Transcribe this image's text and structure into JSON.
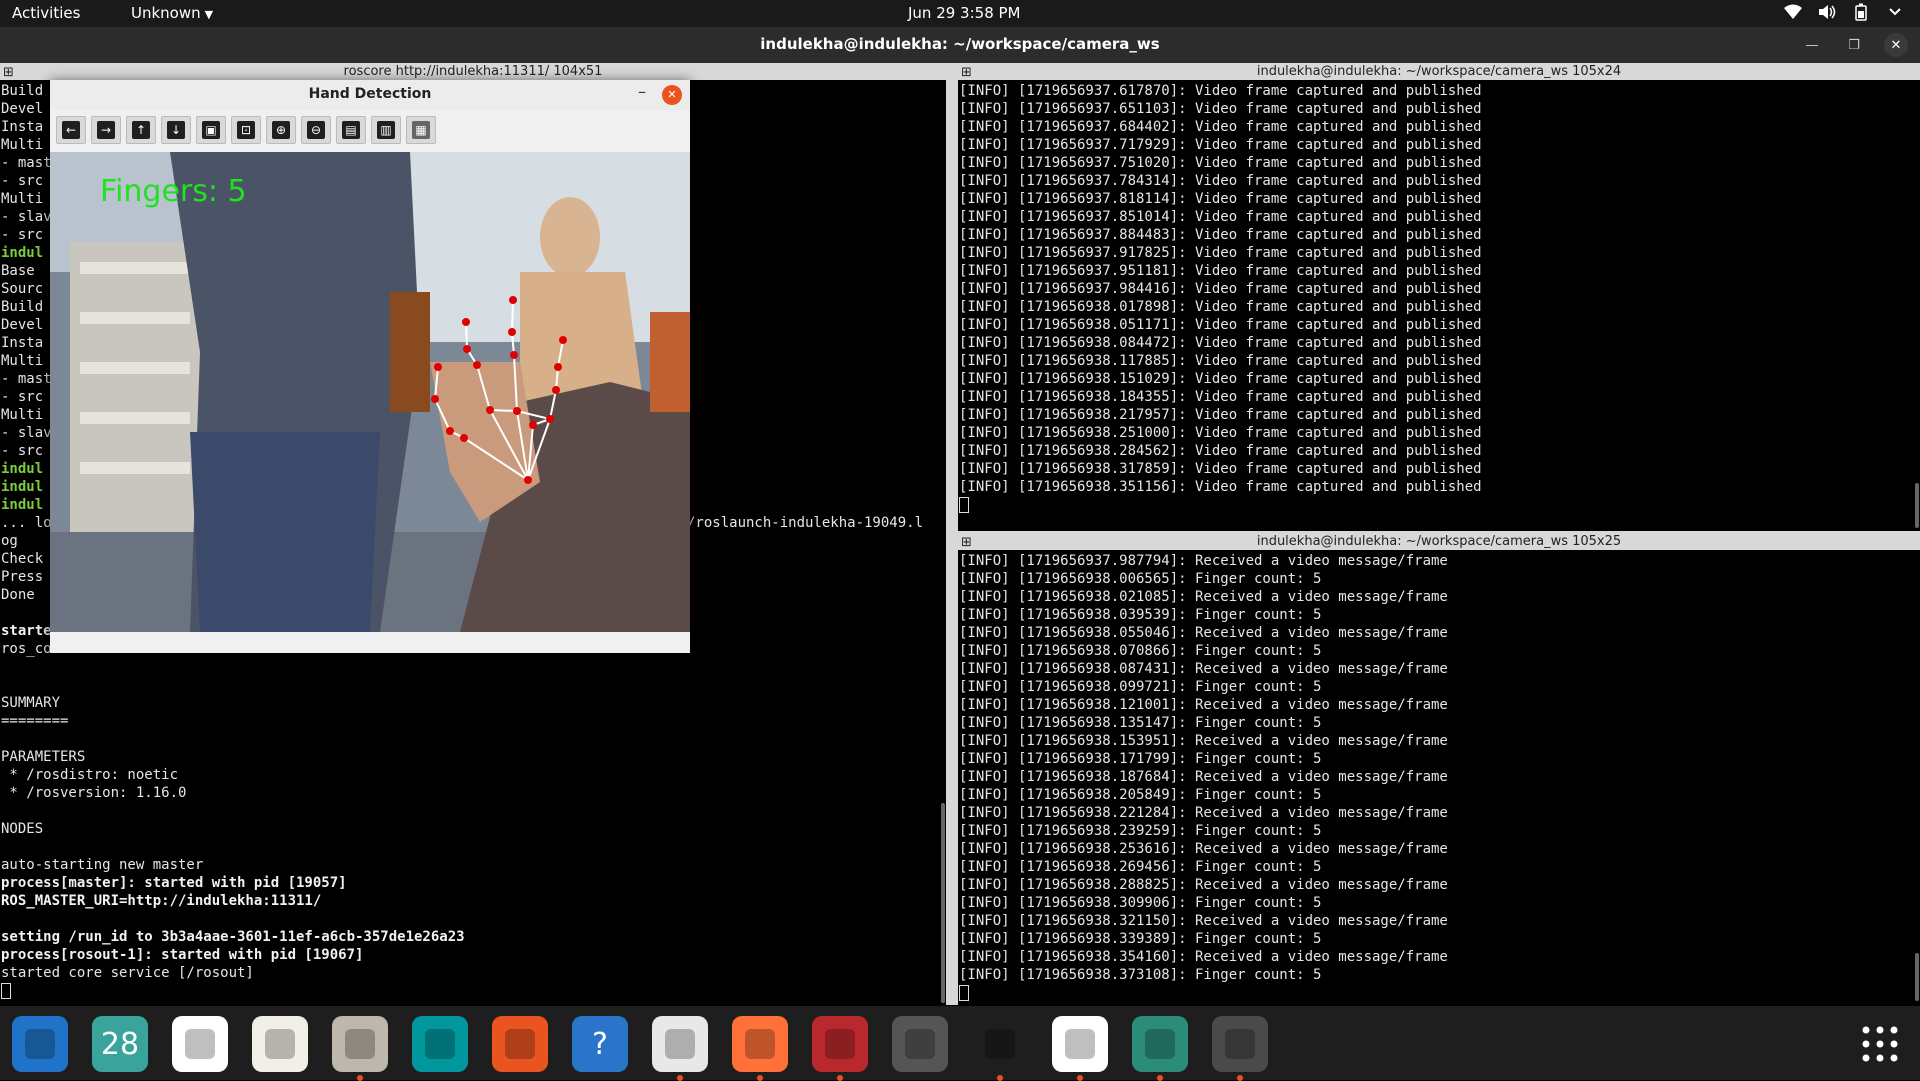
{
  "topbar": {
    "activities": "Activities",
    "app_menu": "Unknown",
    "clock": "Jun 29  3:58 PM"
  },
  "window": {
    "title": "indulekha@indulekha: ~/workspace/camera_ws"
  },
  "left_pane": {
    "title": "roscore http://indulekha:11311/ 104x51",
    "lines_top": [
      {
        "t": "Build",
        "c": ""
      },
      {
        "t": "Devel",
        "c": ""
      },
      {
        "t": "Insta",
        "c": ""
      },
      {
        "t": "Multi",
        "c": ""
      },
      {
        "t": "- mast",
        "c": ""
      },
      {
        "t": "- src",
        "c": ""
      },
      {
        "t": "Multi",
        "c": ""
      },
      {
        "t": "- slav",
        "c": ""
      },
      {
        "t": "- src",
        "c": ""
      },
      {
        "t": "indul",
        "c": "g"
      },
      {
        "t": "Base",
        "c": ""
      },
      {
        "t": "Sourc",
        "c": ""
      },
      {
        "t": "Build",
        "c": ""
      },
      {
        "t": "Devel",
        "c": ""
      },
      {
        "t": "Insta",
        "c": ""
      },
      {
        "t": "Multi",
        "c": ""
      },
      {
        "t": "- mast",
        "c": ""
      },
      {
        "t": "- src",
        "c": ""
      },
      {
        "t": "Multi",
        "c": ""
      },
      {
        "t": "- slav",
        "c": ""
      },
      {
        "t": "- src",
        "c": ""
      },
      {
        "t": "indul",
        "c": "g"
      },
      {
        "t": "indul",
        "c": "g"
      },
      {
        "t": "indul",
        "c": "g"
      },
      {
        "t": "... lo",
        "c": ""
      },
      {
        "t": "og",
        "c": ""
      },
      {
        "t": "Check",
        "c": ""
      },
      {
        "t": "Press",
        "c": ""
      },
      {
        "t": "Done",
        "c": ""
      },
      {
        "t": "",
        "c": ""
      },
      {
        "t": "starte",
        "c": "b"
      },
      {
        "t": "ros_co",
        "c": ""
      }
    ],
    "log_path_fragment": "/roslaunch-indulekha-19049.l",
    "lines_bottom": [
      {
        "t": "",
        "c": ""
      },
      {
        "t": "",
        "c": ""
      },
      {
        "t": "SUMMARY",
        "c": ""
      },
      {
        "t": "========",
        "c": ""
      },
      {
        "t": "",
        "c": ""
      },
      {
        "t": "PARAMETERS",
        "c": ""
      },
      {
        "t": " * /rosdistro: noetic",
        "c": ""
      },
      {
        "t": " * /rosversion: 1.16.0",
        "c": ""
      },
      {
        "t": "",
        "c": ""
      },
      {
        "t": "NODES",
        "c": ""
      },
      {
        "t": "",
        "c": ""
      },
      {
        "t": "auto-starting new master",
        "c": ""
      },
      {
        "t": "process[master]: started with pid [19057]",
        "c": "b"
      },
      {
        "t": "ROS_MASTER_URI=http://indulekha:11311/",
        "c": "b"
      },
      {
        "t": "",
        "c": ""
      },
      {
        "t": "setting /run_id to 3b3a4aae-3601-11ef-a6cb-357de1e26a23",
        "c": "b"
      },
      {
        "t": "process[rosout-1]: started with pid [19067]",
        "c": "b"
      },
      {
        "t": "started core service [/rosout]",
        "c": ""
      }
    ]
  },
  "top_right_pane": {
    "title": "indulekha@indulekha: ~/workspace/camera_ws 105x24",
    "lines": [
      "[INFO] [1719656937.617870]: Video frame captured and published",
      "[INFO] [1719656937.651103]: Video frame captured and published",
      "[INFO] [1719656937.684402]: Video frame captured and published",
      "[INFO] [1719656937.717929]: Video frame captured and published",
      "[INFO] [1719656937.751020]: Video frame captured and published",
      "[INFO] [1719656937.784314]: Video frame captured and published",
      "[INFO] [1719656937.818114]: Video frame captured and published",
      "[INFO] [1719656937.851014]: Video frame captured and published",
      "[INFO] [1719656937.884483]: Video frame captured and published",
      "[INFO] [1719656937.917825]: Video frame captured and published",
      "[INFO] [1719656937.951181]: Video frame captured and published",
      "[INFO] [1719656937.984416]: Video frame captured and published",
      "[INFO] [1719656938.017898]: Video frame captured and published",
      "[INFO] [1719656938.051171]: Video frame captured and published",
      "[INFO] [1719656938.084472]: Video frame captured and published",
      "[INFO] [1719656938.117885]: Video frame captured and published",
      "[INFO] [1719656938.151029]: Video frame captured and published",
      "[INFO] [1719656938.184355]: Video frame captured and published",
      "[INFO] [1719656938.217957]: Video frame captured and published",
      "[INFO] [1719656938.251000]: Video frame captured and published",
      "[INFO] [1719656938.284562]: Video frame captured and published",
      "[INFO] [1719656938.317859]: Video frame captured and published",
      "[INFO] [1719656938.351156]: Video frame captured and published"
    ]
  },
  "bottom_right_pane": {
    "title": "indulekha@indulekha: ~/workspace/camera_ws 105x25",
    "lines": [
      "[INFO] [1719656937.987794]: Received a video message/frame",
      "[INFO] [1719656938.006565]: Finger count: 5",
      "[INFO] [1719656938.021085]: Received a video message/frame",
      "[INFO] [1719656938.039539]: Finger count: 5",
      "[INFO] [1719656938.055046]: Received a video message/frame",
      "[INFO] [1719656938.070866]: Finger count: 5",
      "[INFO] [1719656938.087431]: Received a video message/frame",
      "[INFO] [1719656938.099721]: Finger count: 5",
      "[INFO] [1719656938.121001]: Received a video message/frame",
      "[INFO] [1719656938.135147]: Finger count: 5",
      "[INFO] [1719656938.153951]: Received a video message/frame",
      "[INFO] [1719656938.171799]: Finger count: 5",
      "[INFO] [1719656938.187684]: Received a video message/frame",
      "[INFO] [1719656938.205849]: Finger count: 5",
      "[INFO] [1719656938.221284]: Received a video message/frame",
      "[INFO] [1719656938.239259]: Finger count: 5",
      "[INFO] [1719656938.253616]: Received a video message/frame",
      "[INFO] [1719656938.269456]: Finger count: 5",
      "[INFO] [1719656938.288825]: Received a video message/frame",
      "[INFO] [1719656938.309906]: Finger count: 5",
      "[INFO] [1719656938.321150]: Received a video message/frame",
      "[INFO] [1719656938.339389]: Finger count: 5",
      "[INFO] [1719656938.354160]: Received a video message/frame",
      "[INFO] [1719656938.373108]: Finger count: 5"
    ]
  },
  "hand_window": {
    "title": "Hand Detection",
    "overlay_text": "Fingers: 5",
    "tools": [
      "arrow-left-icon",
      "arrow-right-icon",
      "arrow-up-icon",
      "arrow-down-icon",
      "image-icon",
      "image-options-icon",
      "zoom-in-icon",
      "zoom-out-icon",
      "save-icon",
      "clipboard-icon",
      "properties-icon"
    ]
  },
  "dock": {
    "apps": [
      {
        "name": "thunderbird",
        "label": "",
        "running": false,
        "color": "#1f74c9"
      },
      {
        "name": "calendar",
        "label": "28",
        "running": false,
        "color": "#3aa39b"
      },
      {
        "name": "writer",
        "label": "",
        "running": false,
        "color": "#ffffff"
      },
      {
        "name": "rhythmbox",
        "label": "",
        "running": false,
        "color": "#f2f0e6"
      },
      {
        "name": "files",
        "label": "",
        "running": true,
        "color": "#bdb7ac"
      },
      {
        "name": "arduino",
        "label": "",
        "running": false,
        "color": "#00979d"
      },
      {
        "name": "software",
        "label": "",
        "running": false,
        "color": "#e95420"
      },
      {
        "name": "help",
        "label": "?",
        "running": false,
        "color": "#2a74c9"
      },
      {
        "name": "chrome",
        "label": "",
        "running": true,
        "color": "#e8e8e8"
      },
      {
        "name": "firefox",
        "label": "",
        "running": true,
        "color": "#ff7139"
      },
      {
        "name": "app-red",
        "label": "",
        "running": true,
        "color": "#b9282d"
      },
      {
        "name": "software-updater",
        "label": "",
        "running": false,
        "color": "#555555"
      },
      {
        "name": "vscode",
        "label": "",
        "running": true,
        "color": "#1e1e1e"
      },
      {
        "name": "text-editor",
        "label": "",
        "running": true,
        "color": "#ffffff"
      },
      {
        "name": "app-installer",
        "label": "",
        "running": true,
        "color": "#2b8c7a"
      },
      {
        "name": "terminal",
        "label": "",
        "running": true,
        "color": "#4a4a4a"
      }
    ]
  }
}
